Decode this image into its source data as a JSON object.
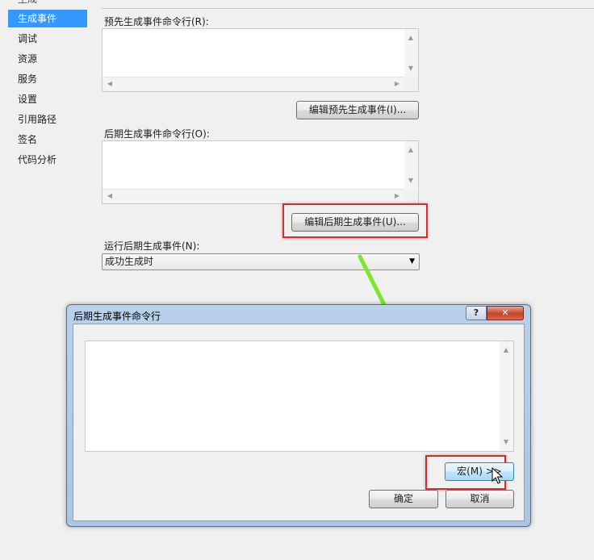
{
  "sidebar": {
    "items": [
      {
        "label": "生成",
        "active": false
      },
      {
        "label": "生成事件",
        "active": true
      },
      {
        "label": "调试",
        "active": false
      },
      {
        "label": "资源",
        "active": false
      },
      {
        "label": "服务",
        "active": false
      },
      {
        "label": "设置",
        "active": false
      },
      {
        "label": "引用路径",
        "active": false
      },
      {
        "label": "签名",
        "active": false
      },
      {
        "label": "代码分析",
        "active": false
      }
    ]
  },
  "main": {
    "prebuild_label": "预先生成事件命令行(R):",
    "prebuild_value": "",
    "edit_prebuild_button": "编辑预先生成事件(I)...",
    "postbuild_label": "后期生成事件命令行(O):",
    "postbuild_value": "",
    "edit_postbuild_button": "编辑后期生成事件(U)...",
    "run_postbuild_label": "运行后期生成事件(N):",
    "run_postbuild_selected": "成功生成时"
  },
  "dialog": {
    "title": "后期生成事件命令行",
    "help_glyph": "?",
    "close_glyph": "✕",
    "command_value": "",
    "macro_button": "宏(M) >>",
    "ok_button": "确定",
    "cancel_button": "取消"
  },
  "colors": {
    "accent": "#3399ff",
    "highlight_box": "#e0262b",
    "arrow": "#7ee62a",
    "dialog_frame": "#b9d1ea"
  },
  "icons": {
    "scroll_up": "▲",
    "scroll_down": "▼",
    "scroll_left": "◀",
    "scroll_right": "▶",
    "dropdown": "▼"
  }
}
